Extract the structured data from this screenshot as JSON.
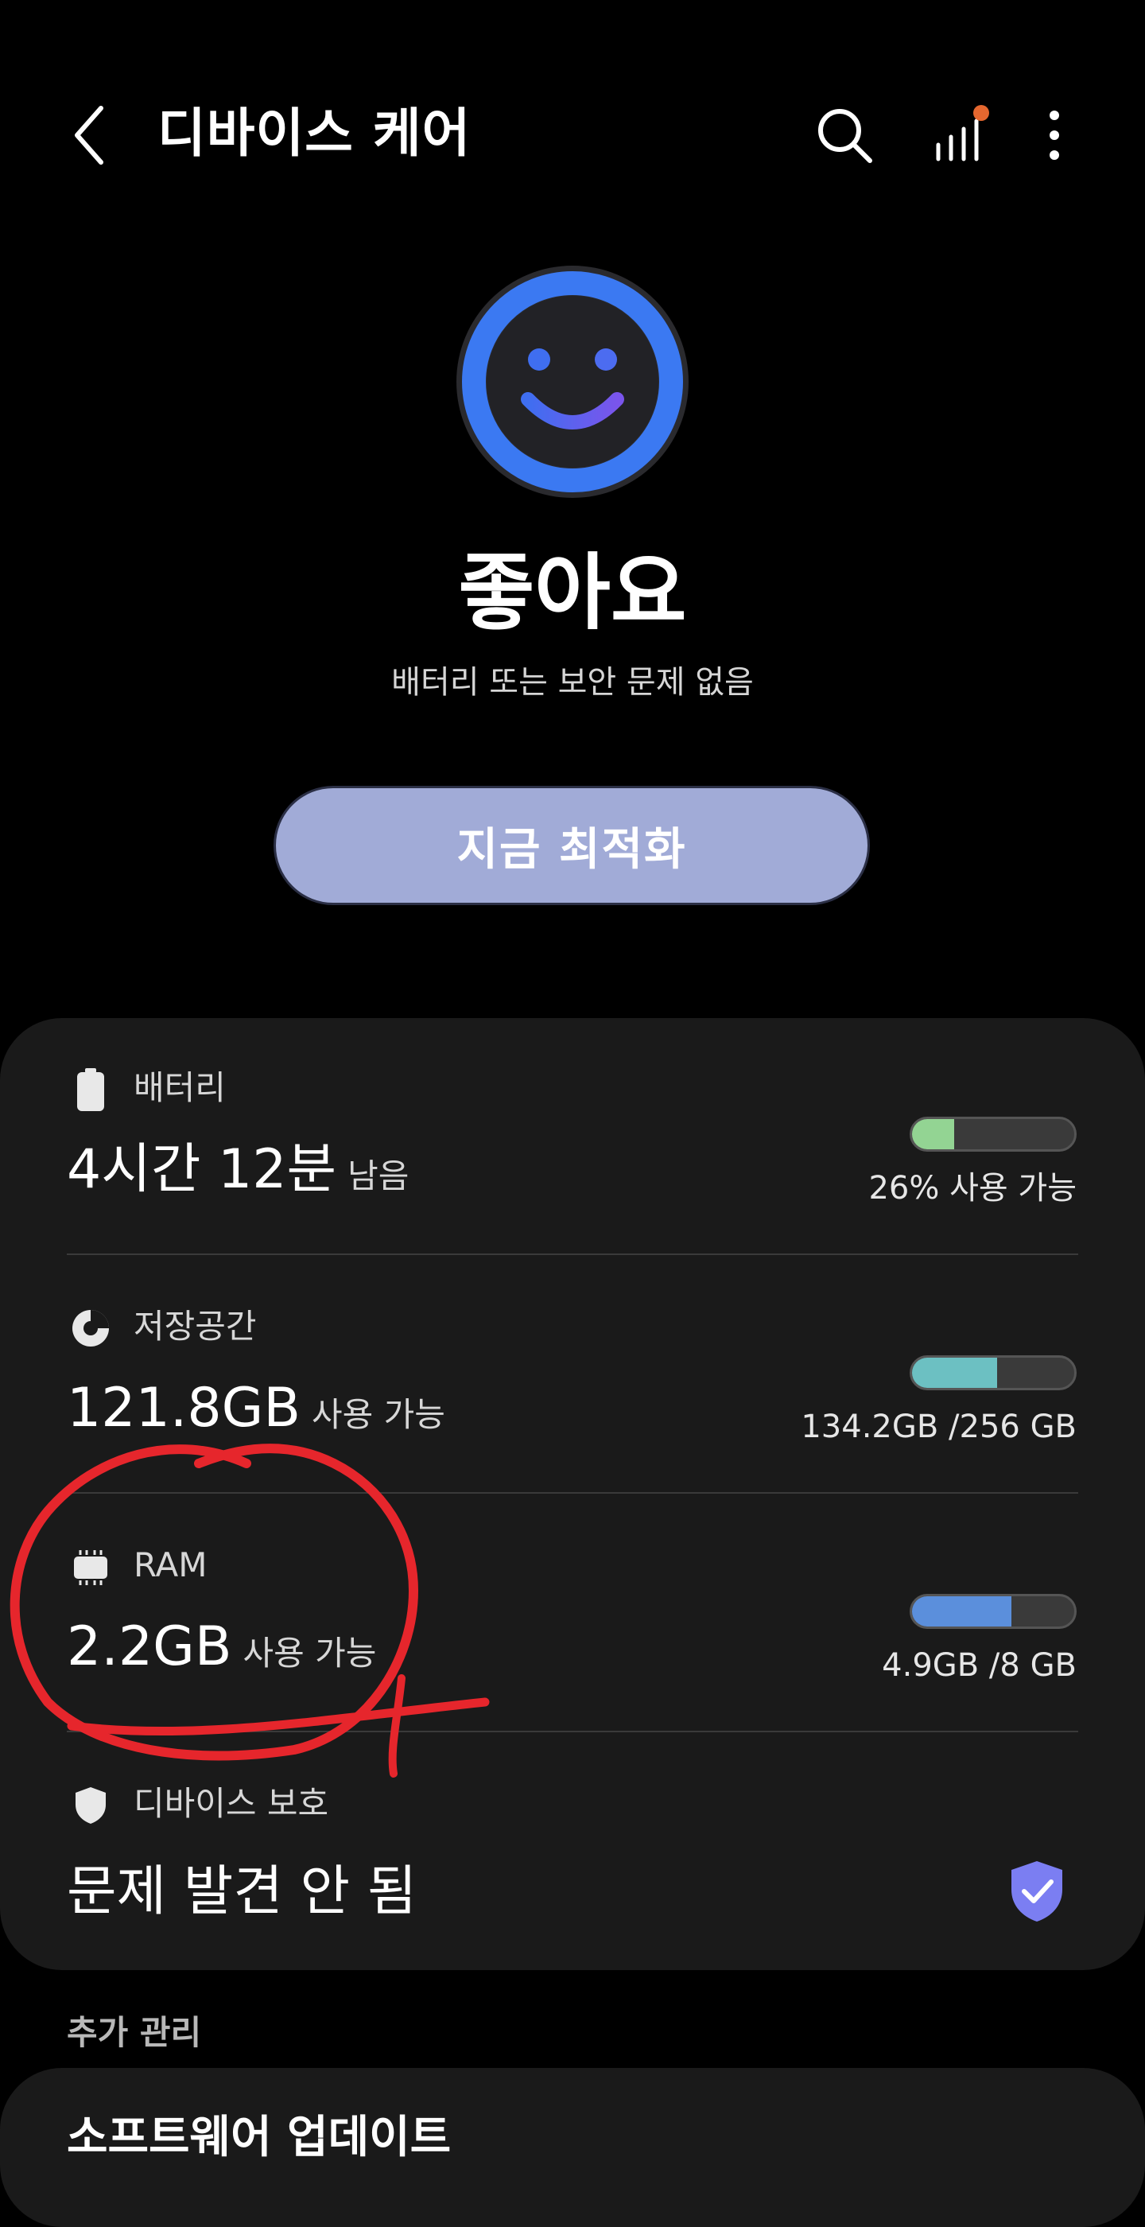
{
  "header": {
    "title": "디바이스 케어",
    "back_icon": "chevron-left-icon",
    "search_icon": "search-icon",
    "stats_icon": "signal-bars-icon",
    "more_icon": "more-vertical-icon",
    "notification_dot_color": "#e5672f"
  },
  "status": {
    "title": "좋아요",
    "subtitle": "배터리 또는 보안 문제 없음",
    "face_ring_color": "#3b79f2"
  },
  "optimize_button": {
    "label": "지금 최적화"
  },
  "battery": {
    "label": "배터리",
    "value": "4시간 12분",
    "unit": "남음",
    "right_text": "26% 사용 가능",
    "level": 0.26,
    "bar_color": "#93d493"
  },
  "storage": {
    "label": "저장공간",
    "value": "121.8GB",
    "unit": "사용 가능",
    "right_text": "134.2GB /256 GB",
    "level": 0.524,
    "bar_color": "#6cc0c2"
  },
  "ram": {
    "label": "RAM",
    "value": "2.2GB",
    "unit": "사용 가능",
    "right_text": "4.9GB /8 GB",
    "level": 0.6125,
    "bar_color": "#5b8fdc"
  },
  "protection": {
    "label": "디바이스 보호",
    "value": "문제 발견 안 됨",
    "badge_color": "#7b7ef2"
  },
  "more": {
    "section_title": "추가 관리",
    "software_update": "소프트웨어 업데이트"
  },
  "annotation_color": "#e6262c"
}
